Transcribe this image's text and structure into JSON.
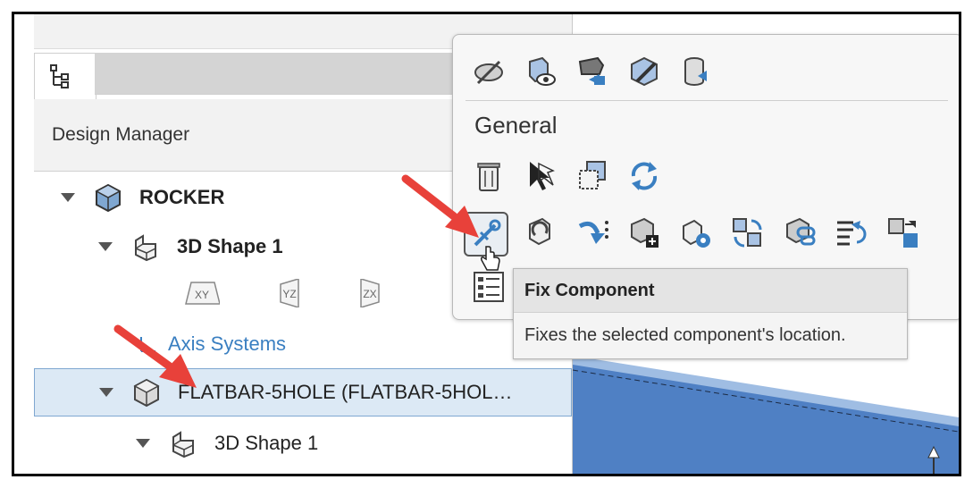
{
  "panel": {
    "title": "Design Manager",
    "tab_icon": "tree-icon"
  },
  "tree": {
    "root": {
      "label": "ROCKER",
      "icon": "assembly-icon"
    },
    "shape1": {
      "label": "3D Shape 1",
      "icon": "shape-icon"
    },
    "planes": [
      {
        "label": "XY",
        "icon": "xy-plane-icon"
      },
      {
        "label": "YZ",
        "icon": "yz-plane-icon"
      },
      {
        "label": "ZX",
        "icon": "zx-plane-icon"
      }
    ],
    "axis_systems": {
      "label": "Axis Systems"
    },
    "flatbar": {
      "label": "FLATBAR-5HOLE (FLATBAR-5HOL…",
      "icon": "component-icon"
    },
    "flatbar_shape": {
      "label": "3D Shape 1",
      "icon": "shape-icon"
    }
  },
  "toolbar": {
    "section_label": "General",
    "top_icons": [
      "hide-icon",
      "show-component-icon",
      "move-down-icon",
      "edit-component-icon",
      "import-icon"
    ],
    "row1_icons": [
      "delete-icon",
      "select-icon",
      "copy-icon",
      "refresh-icon"
    ],
    "row2_icons": [
      "fix-component-icon",
      "rotate-icon",
      "insert-icon",
      "add-component-icon",
      "pattern-icon",
      "regenerate-icon",
      "link-icon",
      "reorder-icon",
      "replace-icon"
    ],
    "row3_icons": [
      "properties-icon"
    ]
  },
  "tooltip": {
    "title": "Fix Component",
    "description": "Fixes the selected component's location."
  },
  "colors": {
    "accent": "#3a7fc1",
    "selection": "#dce9f5",
    "arrow": "#e8413a",
    "model": "#4f80c4"
  }
}
